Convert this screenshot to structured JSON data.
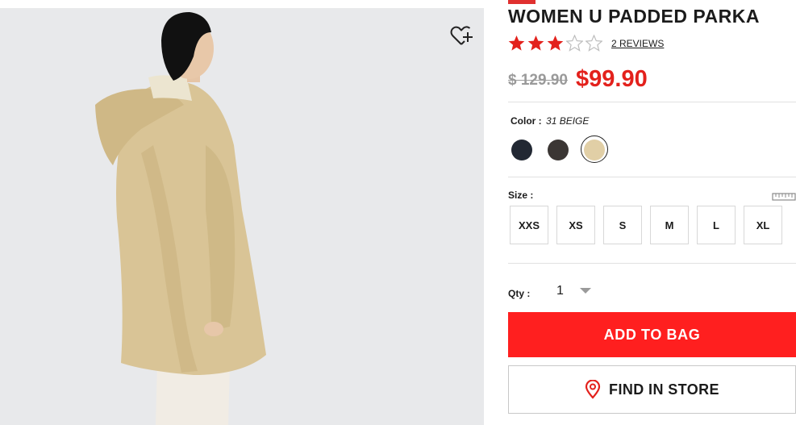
{
  "product": {
    "title": "WOMEN U PADDED PARKA",
    "rating": 3,
    "rating_max": 5,
    "reviews_label": "2 REVIEWS",
    "original_price": "$ 129.90",
    "sale_price": "$99.90"
  },
  "color": {
    "label": "Color :",
    "selected_value": "31 BEIGE",
    "swatches": [
      {
        "name": "navy",
        "hex": "#222833"
      },
      {
        "name": "dark-brown",
        "hex": "#3b3634"
      },
      {
        "name": "beige",
        "hex": "#e1cfa6"
      }
    ],
    "selected_index": 2
  },
  "size": {
    "label": "Size :",
    "options": [
      "XXS",
      "XS",
      "S",
      "M",
      "L",
      "XL"
    ]
  },
  "quantity": {
    "label": "Qty :",
    "value": "1"
  },
  "actions": {
    "add_to_bag": "ADD TO BAG",
    "find_in_store": "FIND IN STORE"
  },
  "icons": {
    "wishlist": "heart-plus-icon",
    "size_guide": "ruler-icon",
    "store": "location-pin-icon",
    "qty_dropdown": "caret-down-icon"
  },
  "colors": {
    "accent": "#ff1f1f",
    "price": "#e3211c",
    "star": "#e3211c",
    "star_empty": "#bdbdbd"
  }
}
